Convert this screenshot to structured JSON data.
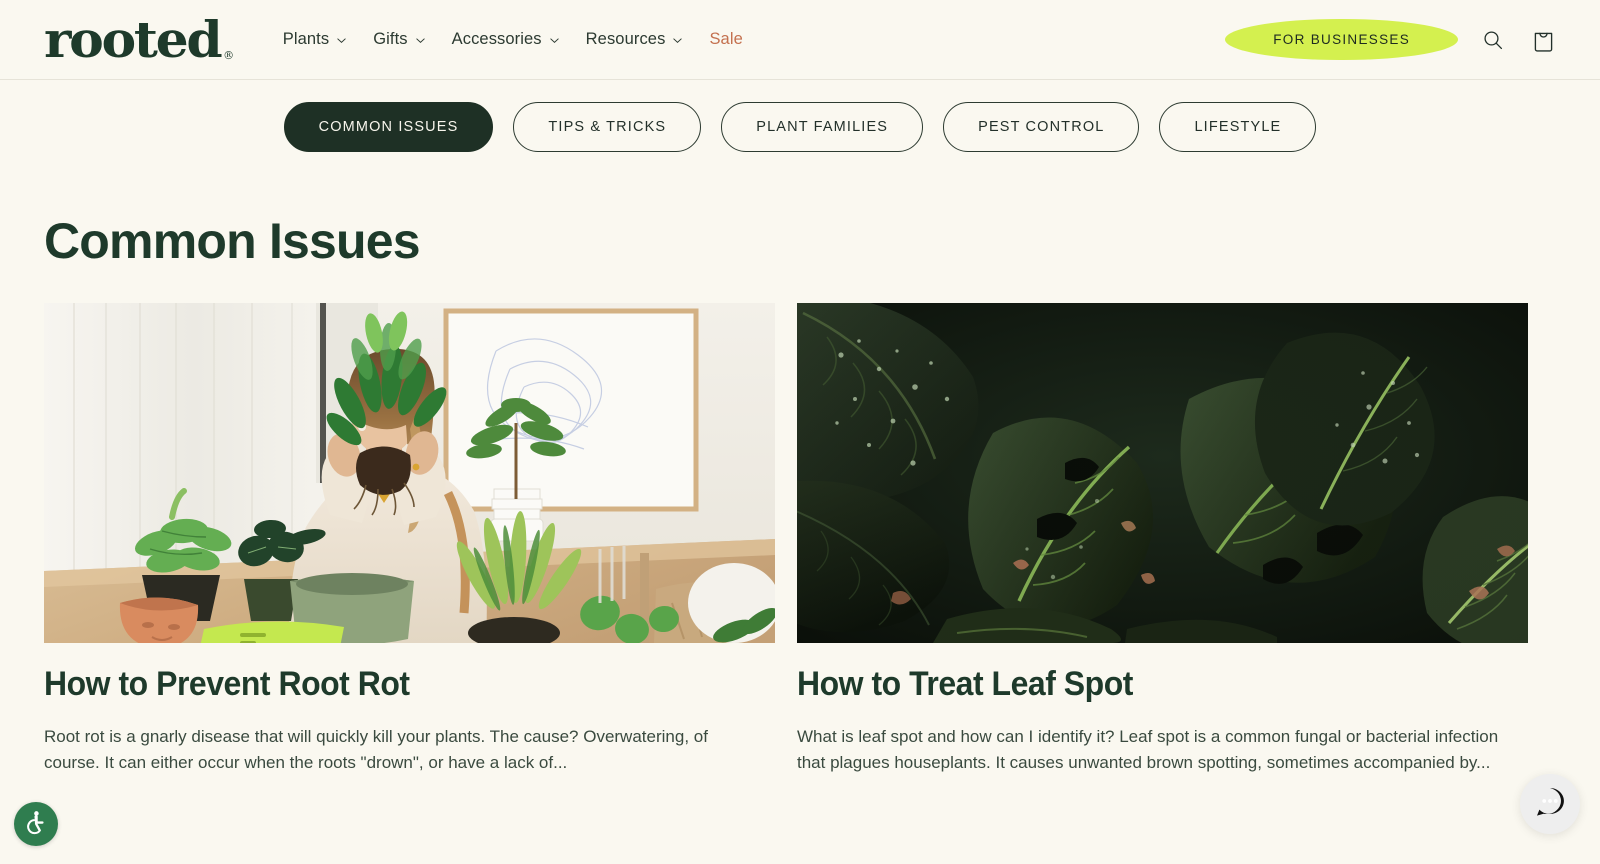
{
  "brand": {
    "name": "rooted",
    "trademark": "®",
    "colors": {
      "background": "#faf8f0",
      "dark_green": "#1e3a2b",
      "lime": "#d4f04f",
      "sale_terracotta": "#c4714f",
      "pill_active_bg": "#1e3025"
    }
  },
  "header": {
    "nav": [
      {
        "label": "Plants",
        "has_dropdown": true,
        "icon": "chevron-down-icon"
      },
      {
        "label": "Gifts",
        "has_dropdown": true,
        "icon": "chevron-down-icon"
      },
      {
        "label": "Accessories",
        "has_dropdown": true,
        "icon": "chevron-down-icon"
      },
      {
        "label": "Resources",
        "has_dropdown": true,
        "icon": "chevron-down-icon"
      },
      {
        "label": "Sale",
        "has_dropdown": false,
        "icon": ""
      }
    ],
    "business_button": "FOR BUSINESSES",
    "search_icon": "search-icon",
    "cart_icon": "shopping-bag-icon"
  },
  "categories": [
    {
      "label": "COMMON ISSUES",
      "active": true
    },
    {
      "label": "TIPS & TRICKS",
      "active": false
    },
    {
      "label": "PLANT FAMILIES",
      "active": false
    },
    {
      "label": "PEST CONTROL",
      "active": false
    },
    {
      "label": "LIFESTYLE",
      "active": false
    }
  ],
  "main": {
    "title": "Common Issues",
    "articles": [
      {
        "title": "How to Prevent Root Rot",
        "excerpt": "Root rot is a gnarly disease that will quickly kill your plants. The cause? Overwatering, of course. It can either occur when the roots \"drown\", or have a lack of...",
        "image_alt": "Woman inspecting the roots of a potted houseplant by a bright window"
      },
      {
        "title": "How to Treat Leaf Spot",
        "excerpt": "What is leaf spot and how can I identify it? Leaf spot is a common fungal or bacterial infection that plagues houseplants. It causes unwanted brown spotting, sometimes accompanied by...",
        "image_alt": "Dark moody close-up of large tropical leaves covered in water droplets"
      }
    ]
  },
  "widgets": {
    "accessibility_icon": "wheelchair-accessibility-icon",
    "chat_icon": "chat-bubble-icon"
  }
}
